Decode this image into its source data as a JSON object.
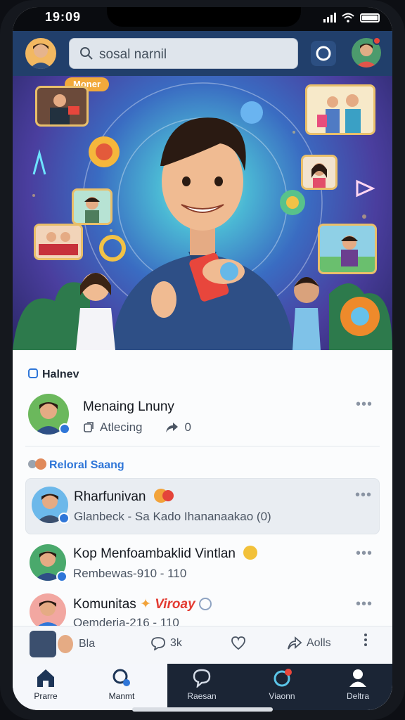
{
  "status": {
    "time": "19:09"
  },
  "search": {
    "placeholder": "sosal narnil"
  },
  "hero": {
    "ribbon": "Moner"
  },
  "feed": {
    "section_1": "Halnev",
    "post_1": {
      "title": "Menaing Lnuny",
      "meta_label": "Atlecing",
      "share_count": "0"
    },
    "section_2": "Reloral Saang",
    "posts": [
      {
        "title": "Rharfunivan",
        "subtitle": "Glanbeck - Sa Kado Ihananaakao (0)"
      },
      {
        "title": "Kop Menfoambaklid Vintlan",
        "subtitle": "Rembewas-910 - 110"
      },
      {
        "title": "Komunitas",
        "highlight": "Viroay",
        "subtitle": "Oemderia-216 - 110"
      }
    ]
  },
  "actions": {
    "left_label": "Bla",
    "comment_count": "3k",
    "share_label": "Aolls"
  },
  "nav": [
    {
      "label": "Prarre",
      "icon": "home-icon"
    },
    {
      "label": "Manmt",
      "icon": "search-icon"
    },
    {
      "label": "Raesan",
      "icon": "chat-icon"
    },
    {
      "label": "Viaonn",
      "icon": "bell-icon"
    },
    {
      "label": "Deltra",
      "icon": "profile-icon"
    }
  ],
  "colors": {
    "accent": "#2f76d8",
    "topbar": "#213f6b",
    "nav_dark": "#1b2535"
  }
}
